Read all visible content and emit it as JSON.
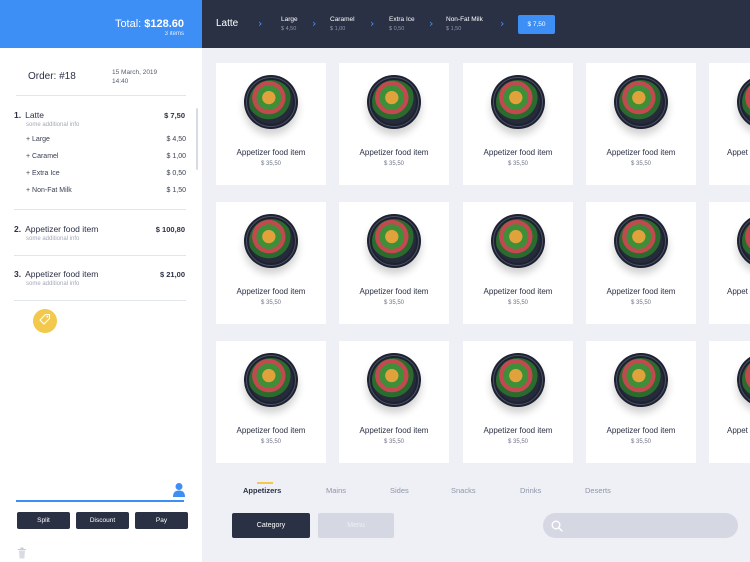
{
  "total": {
    "label": "Total:",
    "amount": "$128.60",
    "items": "3 items"
  },
  "order": {
    "title": "Order: #18",
    "date_line1": "15 March, 2019",
    "date_line2": "14:40",
    "items": [
      {
        "num": "1.",
        "name": "Latte",
        "sub": "some additional info",
        "price": "$ 7,50",
        "modifiers": [
          {
            "name": "+ Large",
            "price": "$ 4,50"
          },
          {
            "name": "+ Caramel",
            "price": "$ 1,00"
          },
          {
            "name": "+ Extra Ice",
            "price": "$ 0,50"
          },
          {
            "name": "+ Non-Fat Milk",
            "price": "$ 1,50"
          }
        ]
      },
      {
        "num": "2.",
        "name": "Appetizer food item",
        "sub": "some additional info",
        "price": "$ 100,80"
      },
      {
        "num": "3.",
        "name": "Appetizer food item",
        "sub": "some additional info",
        "price": "$ 21,00"
      }
    ]
  },
  "note": {
    "value": "",
    "placeholder": ""
  },
  "actions": {
    "split": "Split",
    "discount": "Discount",
    "pay": "Pay"
  },
  "breadcrumb": {
    "main": "Latte",
    "items": [
      {
        "name": "Large",
        "price": "$ 4,50"
      },
      {
        "name": "Caramel",
        "price": "$ 1,00"
      },
      {
        "name": "Extra Ice",
        "price": "$ 0,50"
      },
      {
        "name": "Non-Fat Milk",
        "price": "$ 1,50"
      }
    ],
    "total": "$ 7,50"
  },
  "products": {
    "title": "Appetizer food item",
    "price": "$ 35,50",
    "rows": 3,
    "visible_columns": 4,
    "partial_title": "Appet"
  },
  "categories": {
    "tabs": [
      "Appetizers",
      "Mains",
      "Sides",
      "Snacks",
      "Drinks",
      "Deserts"
    ],
    "active": "Appetizers"
  },
  "buttons": {
    "category": "Category",
    "menu": "Menu"
  },
  "search": {
    "value": "",
    "placeholder": ""
  },
  "colors": {
    "accent": "#3d8ef5",
    "dark": "#2b3145",
    "highlight": "#f2c94c",
    "background": "#eef0f5"
  },
  "icons": {
    "tag": "tag-icon",
    "user": "user-icon",
    "trash": "trash-icon",
    "search": "search-icon",
    "chevron": "chevron-right-icon"
  }
}
